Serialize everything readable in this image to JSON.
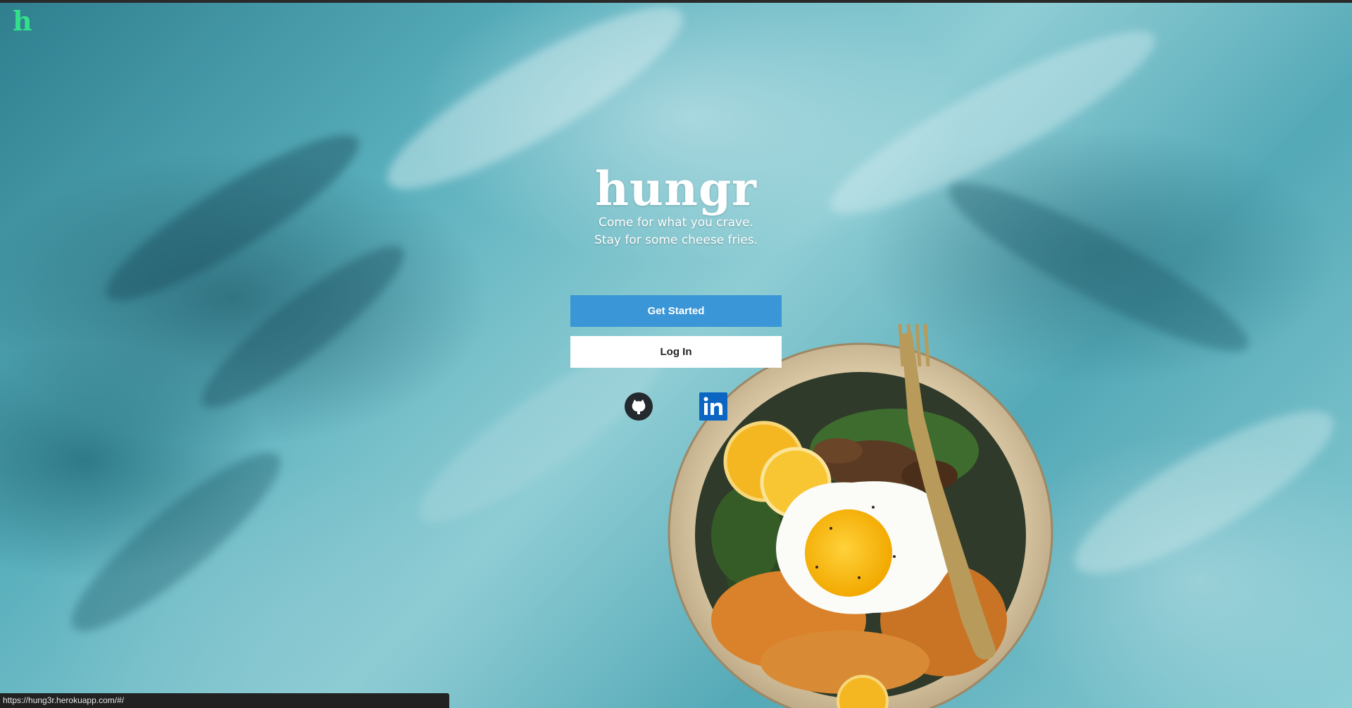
{
  "app": {
    "logo_letter": "h",
    "brand_name": "hungr",
    "tagline_line1": "Come for what you crave.",
    "tagline_line2": "Stay for some cheese fries."
  },
  "actions": {
    "get_started_label": "Get Started",
    "login_label": "Log In"
  },
  "social": {
    "github_icon": "github-icon",
    "linkedin_icon": "linkedin-icon"
  },
  "status_bar": {
    "url": "https://hung3r.herokuapp.com/#/"
  },
  "colors": {
    "logo_accent": "#33e08a",
    "primary_button": "#3a96d6",
    "secondary_button": "#ffffff",
    "linkedin_blue": "#0a66c2",
    "background_teal": "#5fb3c0"
  }
}
